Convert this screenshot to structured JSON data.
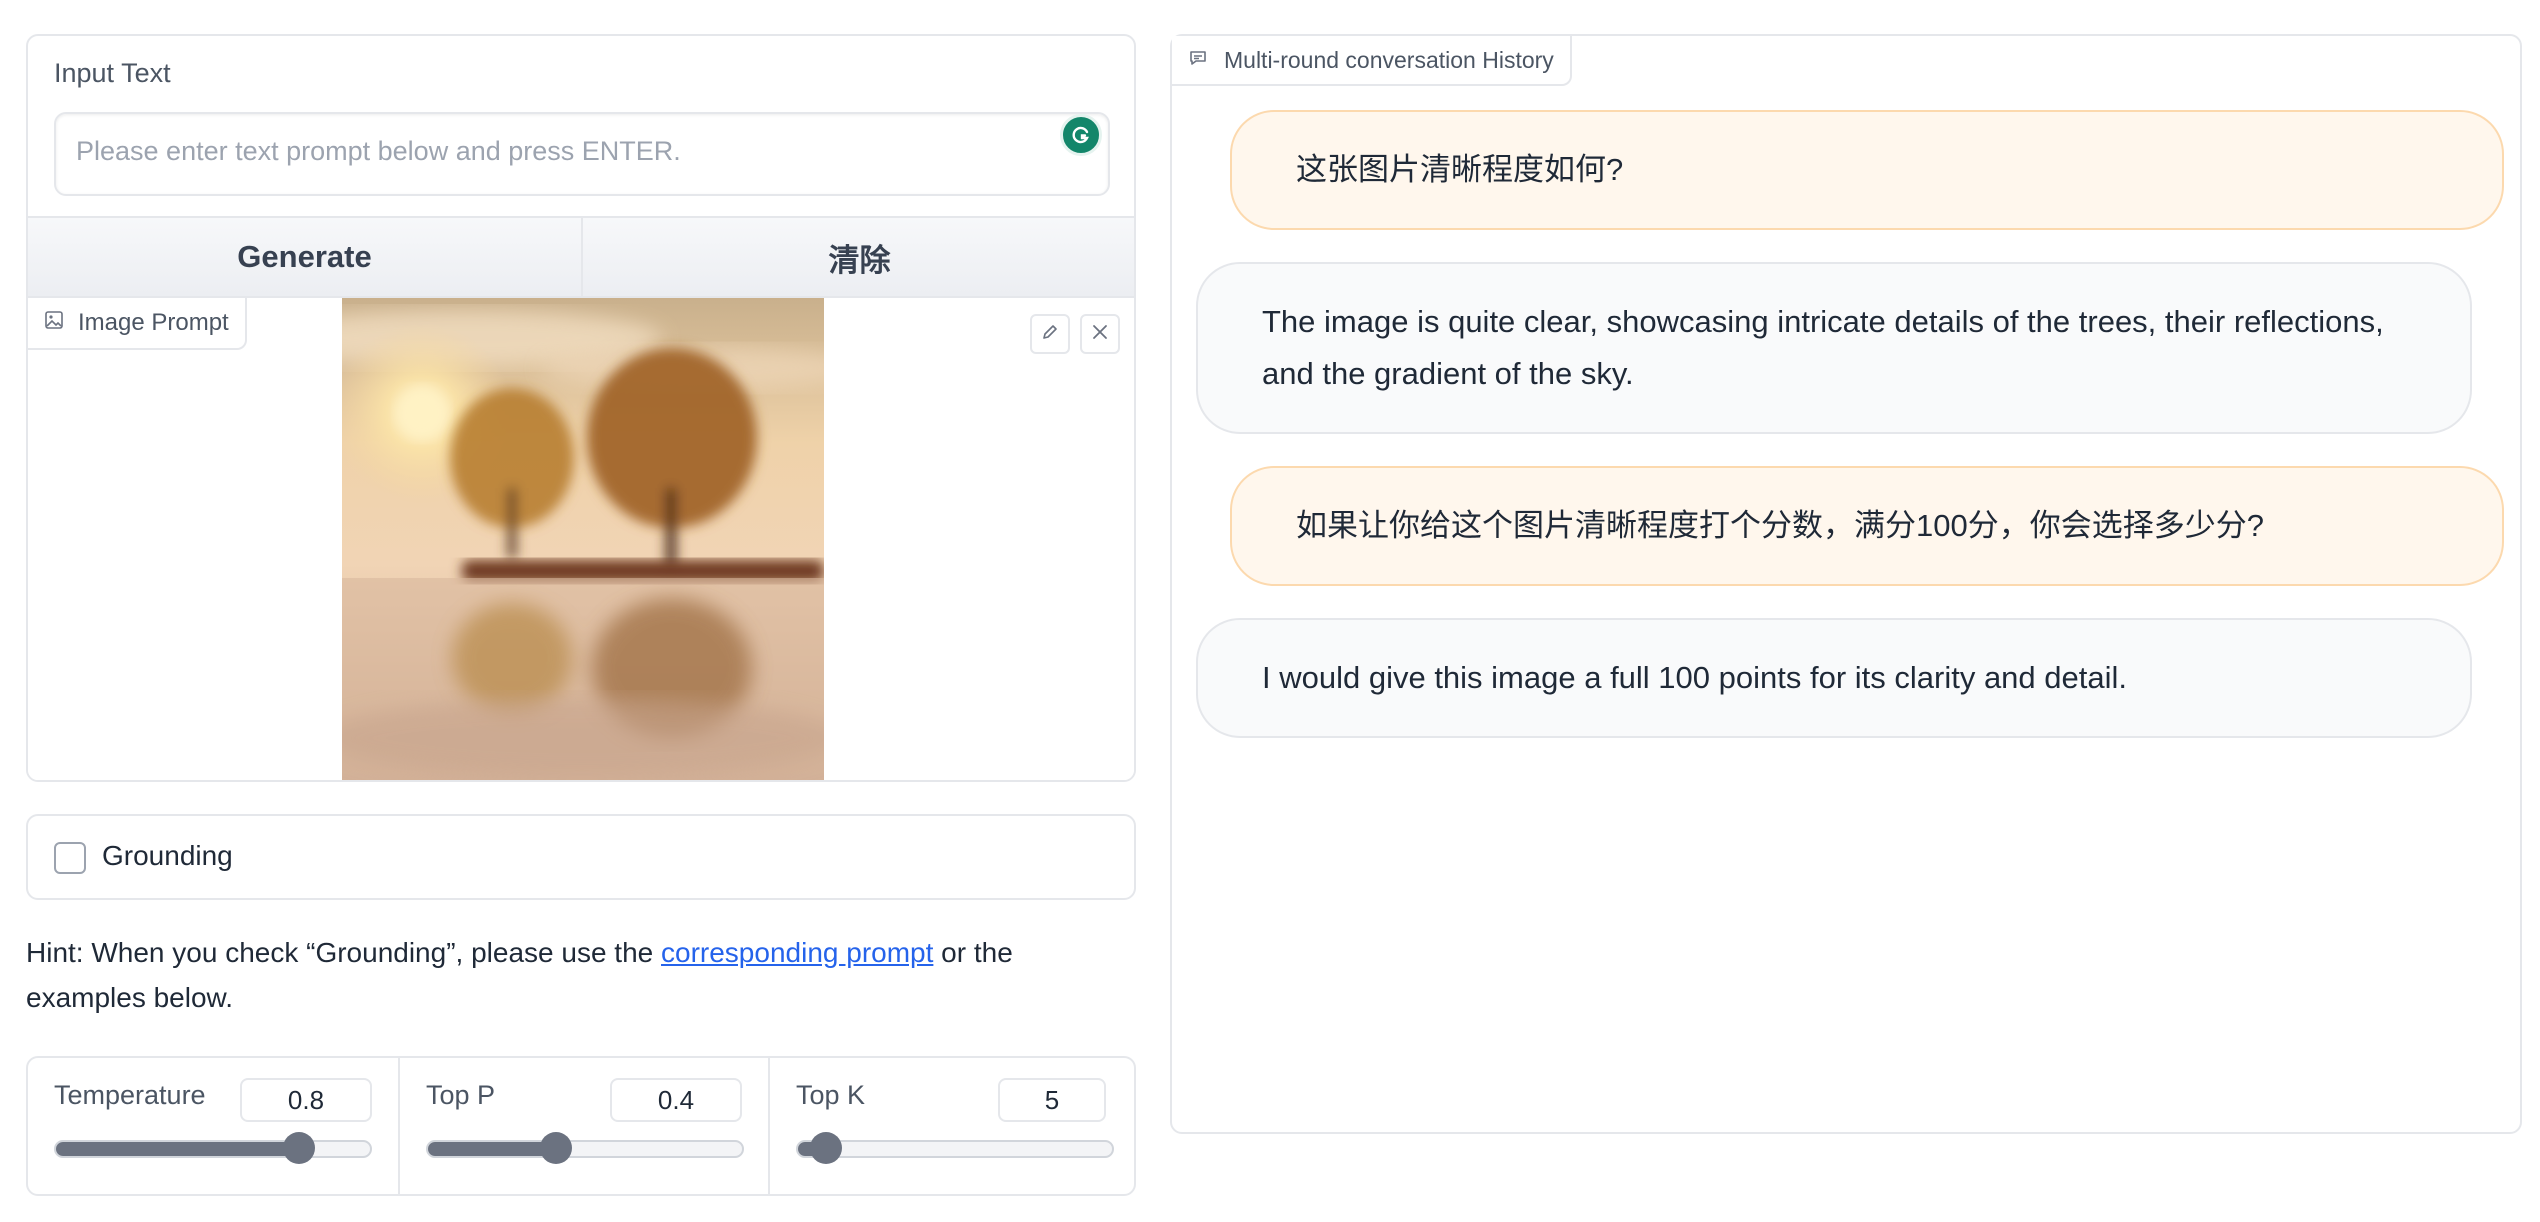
{
  "input": {
    "label": "Input Text",
    "placeholder": "Please enter text prompt below and press ENTER."
  },
  "buttons": {
    "generate": "Generate",
    "clear": "清除"
  },
  "image_prompt": {
    "label": "Image Prompt"
  },
  "grounding": {
    "label": "Grounding",
    "checked": false
  },
  "hint": {
    "prefix": "Hint: When you check “Grounding”, please use the ",
    "link": "corresponding prompt",
    "suffix": " or the examples below."
  },
  "sliders": [
    {
      "label": "Temperature",
      "value": "0.8",
      "fraction": 0.8
    },
    {
      "label": "Top P",
      "value": "0.4",
      "fraction": 0.4
    },
    {
      "label": "Top K",
      "value": "5",
      "fraction": 0.05
    }
  ],
  "chat": {
    "title": "Multi-round conversation History",
    "messages": [
      {
        "role": "user",
        "text": "这张图片清晰程度如何?"
      },
      {
        "role": "bot",
        "text": "The image is quite clear, showcasing intricate details of the trees, their reflections, and the gradient of the sky."
      },
      {
        "role": "user",
        "text": "如果让你给这个图片清晰程度打个分数，满分100分，你会选择多少分?"
      },
      {
        "role": "bot",
        "text": "I would give this image a full 100 points for its clarity and detail."
      }
    ]
  },
  "colors": {
    "user_bubble": "#fff7ed",
    "bot_bubble": "#f9fafb",
    "link": "#2563eb",
    "grammarly": "#13866a"
  },
  "icons": [
    "grammarly-icon",
    "image-icon",
    "pencil-icon",
    "close-icon",
    "chat-icon"
  ]
}
